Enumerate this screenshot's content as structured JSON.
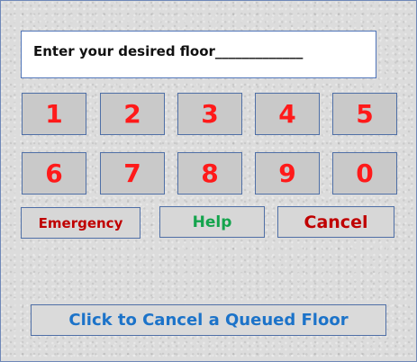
{
  "prompt": {
    "text": "Enter your desired floor_____________"
  },
  "keypad": {
    "row1": [
      "1",
      "2",
      "3",
      "4",
      "5"
    ],
    "row2": [
      "6",
      "7",
      "8",
      "9",
      "0"
    ]
  },
  "actions": {
    "emergency_label": "Emergency",
    "help_label": "Help",
    "cancel_label": "Cancel",
    "queue_cancel_label": "Click to Cancel a Queued Floor"
  },
  "colors": {
    "digit": "#ff1a1a",
    "emergency": "#c00000",
    "help": "#14a44d",
    "cancel": "#c00000",
    "queue_cancel": "#1c73c9",
    "panel_border": "#4f6fa6"
  }
}
